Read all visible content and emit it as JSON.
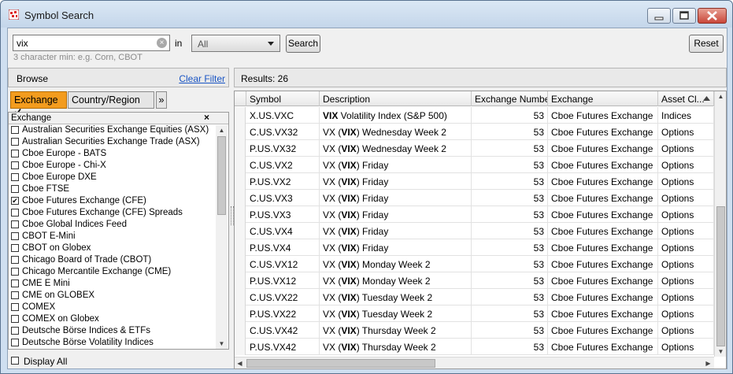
{
  "window": {
    "title": "Symbol Search"
  },
  "search": {
    "value": "vix",
    "hint": "3 character min: e.g. Corn, CBOT",
    "in_label": "in",
    "scope_value": "All",
    "search_button": "Search",
    "reset_button": "Reset"
  },
  "browse": {
    "label": "Browse",
    "clear_filter": "Clear Filter",
    "tabs": [
      {
        "label": "Exchange",
        "active": true
      },
      {
        "label": "Country/Region",
        "active": false
      },
      {
        "label": "»",
        "active": false
      }
    ],
    "list_header": "Exchange",
    "list_close": "×",
    "items": [
      {
        "label": "Australian Securities Exchange Equities (ASX)",
        "checked": false
      },
      {
        "label": "Australian Securities Exchange Trade (ASX)",
        "checked": false
      },
      {
        "label": "Cboe Europe - BATS",
        "checked": false
      },
      {
        "label": "Cboe Europe - Chi-X",
        "checked": false
      },
      {
        "label": "Cboe Europe DXE",
        "checked": false
      },
      {
        "label": "Cboe FTSE",
        "checked": false
      },
      {
        "label": "Cboe Futures Exchange (CFE)",
        "checked": true
      },
      {
        "label": "Cboe Futures Exchange (CFE) Spreads",
        "checked": false
      },
      {
        "label": "Cboe Global Indices Feed",
        "checked": false
      },
      {
        "label": "CBOT E-Mini",
        "checked": false
      },
      {
        "label": "CBOT on Globex",
        "checked": false
      },
      {
        "label": "Chicago Board of Trade (CBOT)",
        "checked": false
      },
      {
        "label": "Chicago Mercantile Exchange (CME)",
        "checked": false
      },
      {
        "label": "CME E Mini",
        "checked": false
      },
      {
        "label": "CME on GLOBEX",
        "checked": false
      },
      {
        "label": "COMEX",
        "checked": false
      },
      {
        "label": "COMEX on Globex",
        "checked": false
      },
      {
        "label": "Deutsche Börse Indices & ETFs",
        "checked": false
      },
      {
        "label": "Deutsche Börse Volatility Indices",
        "checked": false
      }
    ],
    "display_all": "Display All"
  },
  "results": {
    "label": "Results: 26",
    "columns": [
      "Symbol",
      "Description",
      "Exchange Number",
      "Exchange",
      "Asset Cl..."
    ],
    "rows": [
      {
        "symbol": "X.US.VXC",
        "desc_bold": "VIX",
        "desc_pre": "",
        "desc_post": " Volatility Index (S&P 500)",
        "number": "53",
        "exchange": "Cboe Futures Exchange",
        "asset": "Indices"
      },
      {
        "symbol": "C.US.VX32",
        "desc_pre": "VX (",
        "desc_bold": "VIX",
        "desc_post": ") Wednesday Week 2",
        "number": "53",
        "exchange": "Cboe Futures Exchange",
        "asset": "Options"
      },
      {
        "symbol": "P.US.VX32",
        "desc_pre": "VX (",
        "desc_bold": "VIX",
        "desc_post": ") Wednesday Week 2",
        "number": "53",
        "exchange": "Cboe Futures Exchange",
        "asset": "Options"
      },
      {
        "symbol": "C.US.VX2",
        "desc_pre": "VX (",
        "desc_bold": "VIX",
        "desc_post": ") Friday",
        "number": "53",
        "exchange": "Cboe Futures Exchange",
        "asset": "Options"
      },
      {
        "symbol": "P.US.VX2",
        "desc_pre": "VX (",
        "desc_bold": "VIX",
        "desc_post": ") Friday",
        "number": "53",
        "exchange": "Cboe Futures Exchange",
        "asset": "Options"
      },
      {
        "symbol": "C.US.VX3",
        "desc_pre": "VX (",
        "desc_bold": "VIX",
        "desc_post": ") Friday",
        "number": "53",
        "exchange": "Cboe Futures Exchange",
        "asset": "Options"
      },
      {
        "symbol": "P.US.VX3",
        "desc_pre": "VX (",
        "desc_bold": "VIX",
        "desc_post": ") Friday",
        "number": "53",
        "exchange": "Cboe Futures Exchange",
        "asset": "Options"
      },
      {
        "symbol": "C.US.VX4",
        "desc_pre": "VX (",
        "desc_bold": "VIX",
        "desc_post": ") Friday",
        "number": "53",
        "exchange": "Cboe Futures Exchange",
        "asset": "Options"
      },
      {
        "symbol": "P.US.VX4",
        "desc_pre": "VX (",
        "desc_bold": "VIX",
        "desc_post": ") Friday",
        "number": "53",
        "exchange": "Cboe Futures Exchange",
        "asset": "Options"
      },
      {
        "symbol": "C.US.VX12",
        "desc_pre": "VX (",
        "desc_bold": "VIX",
        "desc_post": ") Monday Week 2",
        "number": "53",
        "exchange": "Cboe Futures Exchange",
        "asset": "Options"
      },
      {
        "symbol": "P.US.VX12",
        "desc_pre": "VX (",
        "desc_bold": "VIX",
        "desc_post": ") Monday Week 2",
        "number": "53",
        "exchange": "Cboe Futures Exchange",
        "asset": "Options"
      },
      {
        "symbol": "C.US.VX22",
        "desc_pre": "VX (",
        "desc_bold": "VIX",
        "desc_post": ") Tuesday Week 2",
        "number": "53",
        "exchange": "Cboe Futures Exchange",
        "asset": "Options"
      },
      {
        "symbol": "P.US.VX22",
        "desc_pre": "VX (",
        "desc_bold": "VIX",
        "desc_post": ") Tuesday Week 2",
        "number": "53",
        "exchange": "Cboe Futures Exchange",
        "asset": "Options"
      },
      {
        "symbol": "C.US.VX42",
        "desc_pre": "VX (",
        "desc_bold": "VIX",
        "desc_post": ") Thursday Week 2",
        "number": "53",
        "exchange": "Cboe Futures Exchange",
        "asset": "Options"
      },
      {
        "symbol": "P.US.VX42",
        "desc_pre": "VX (",
        "desc_bold": "VIX",
        "desc_post": ") Thursday Week 2",
        "number": "53",
        "exchange": "Cboe Futures Exchange",
        "asset": "Options"
      }
    ]
  },
  "icons": {
    "app": "app-icon",
    "clear": "clear-x-icon",
    "dropdown": "chevron-down-icon",
    "checkmark": "checkmark-icon",
    "sort": "sort-ascending-icon"
  },
  "colors": {
    "accent_tab": "#f39c1e",
    "link": "#1a55c4",
    "close_button": "#c9473a"
  }
}
